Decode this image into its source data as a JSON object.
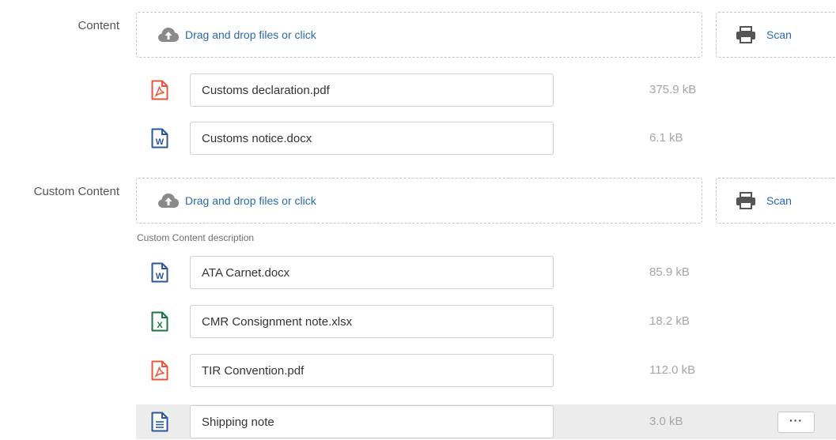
{
  "sections": [
    {
      "label": "Content",
      "dropzone_text": "Drag and drop files or click",
      "scan_label": "Scan",
      "files": [
        {
          "name": "Customs declaration.pdf",
          "size": "375.9 kB",
          "type": "pdf"
        },
        {
          "name": "Customs notice.docx",
          "size": "6.1 kB",
          "type": "word"
        }
      ]
    },
    {
      "label": "Custom Content",
      "dropzone_text": "Drag and drop files or click",
      "scan_label": "Scan",
      "description": "Custom Content description",
      "files": [
        {
          "name": "ATA Carnet.docx",
          "size": "85.9 kB",
          "type": "word"
        },
        {
          "name": "CMR Consignment note.xlsx",
          "size": "18.2 kB",
          "type": "excel"
        },
        {
          "name": "TIR Convention.pdf",
          "size": "112.0 kB",
          "type": "pdf"
        },
        {
          "name": "Shipping note",
          "size": "3.0 kB",
          "type": "text",
          "selected": true,
          "more_label": "···"
        }
      ]
    }
  ],
  "colors": {
    "link": "#2a6ab0",
    "pdf": "#e8553a",
    "word": "#2b579a",
    "excel": "#217346",
    "text_doc": "#2b579a",
    "selected_row": "#ececec"
  },
  "icons": {
    "upload": "cloud-upload-icon",
    "scan": "printer-icon",
    "pdf": "pdf-file-icon",
    "word": "word-file-icon",
    "excel": "excel-file-icon",
    "text": "text-file-icon"
  }
}
